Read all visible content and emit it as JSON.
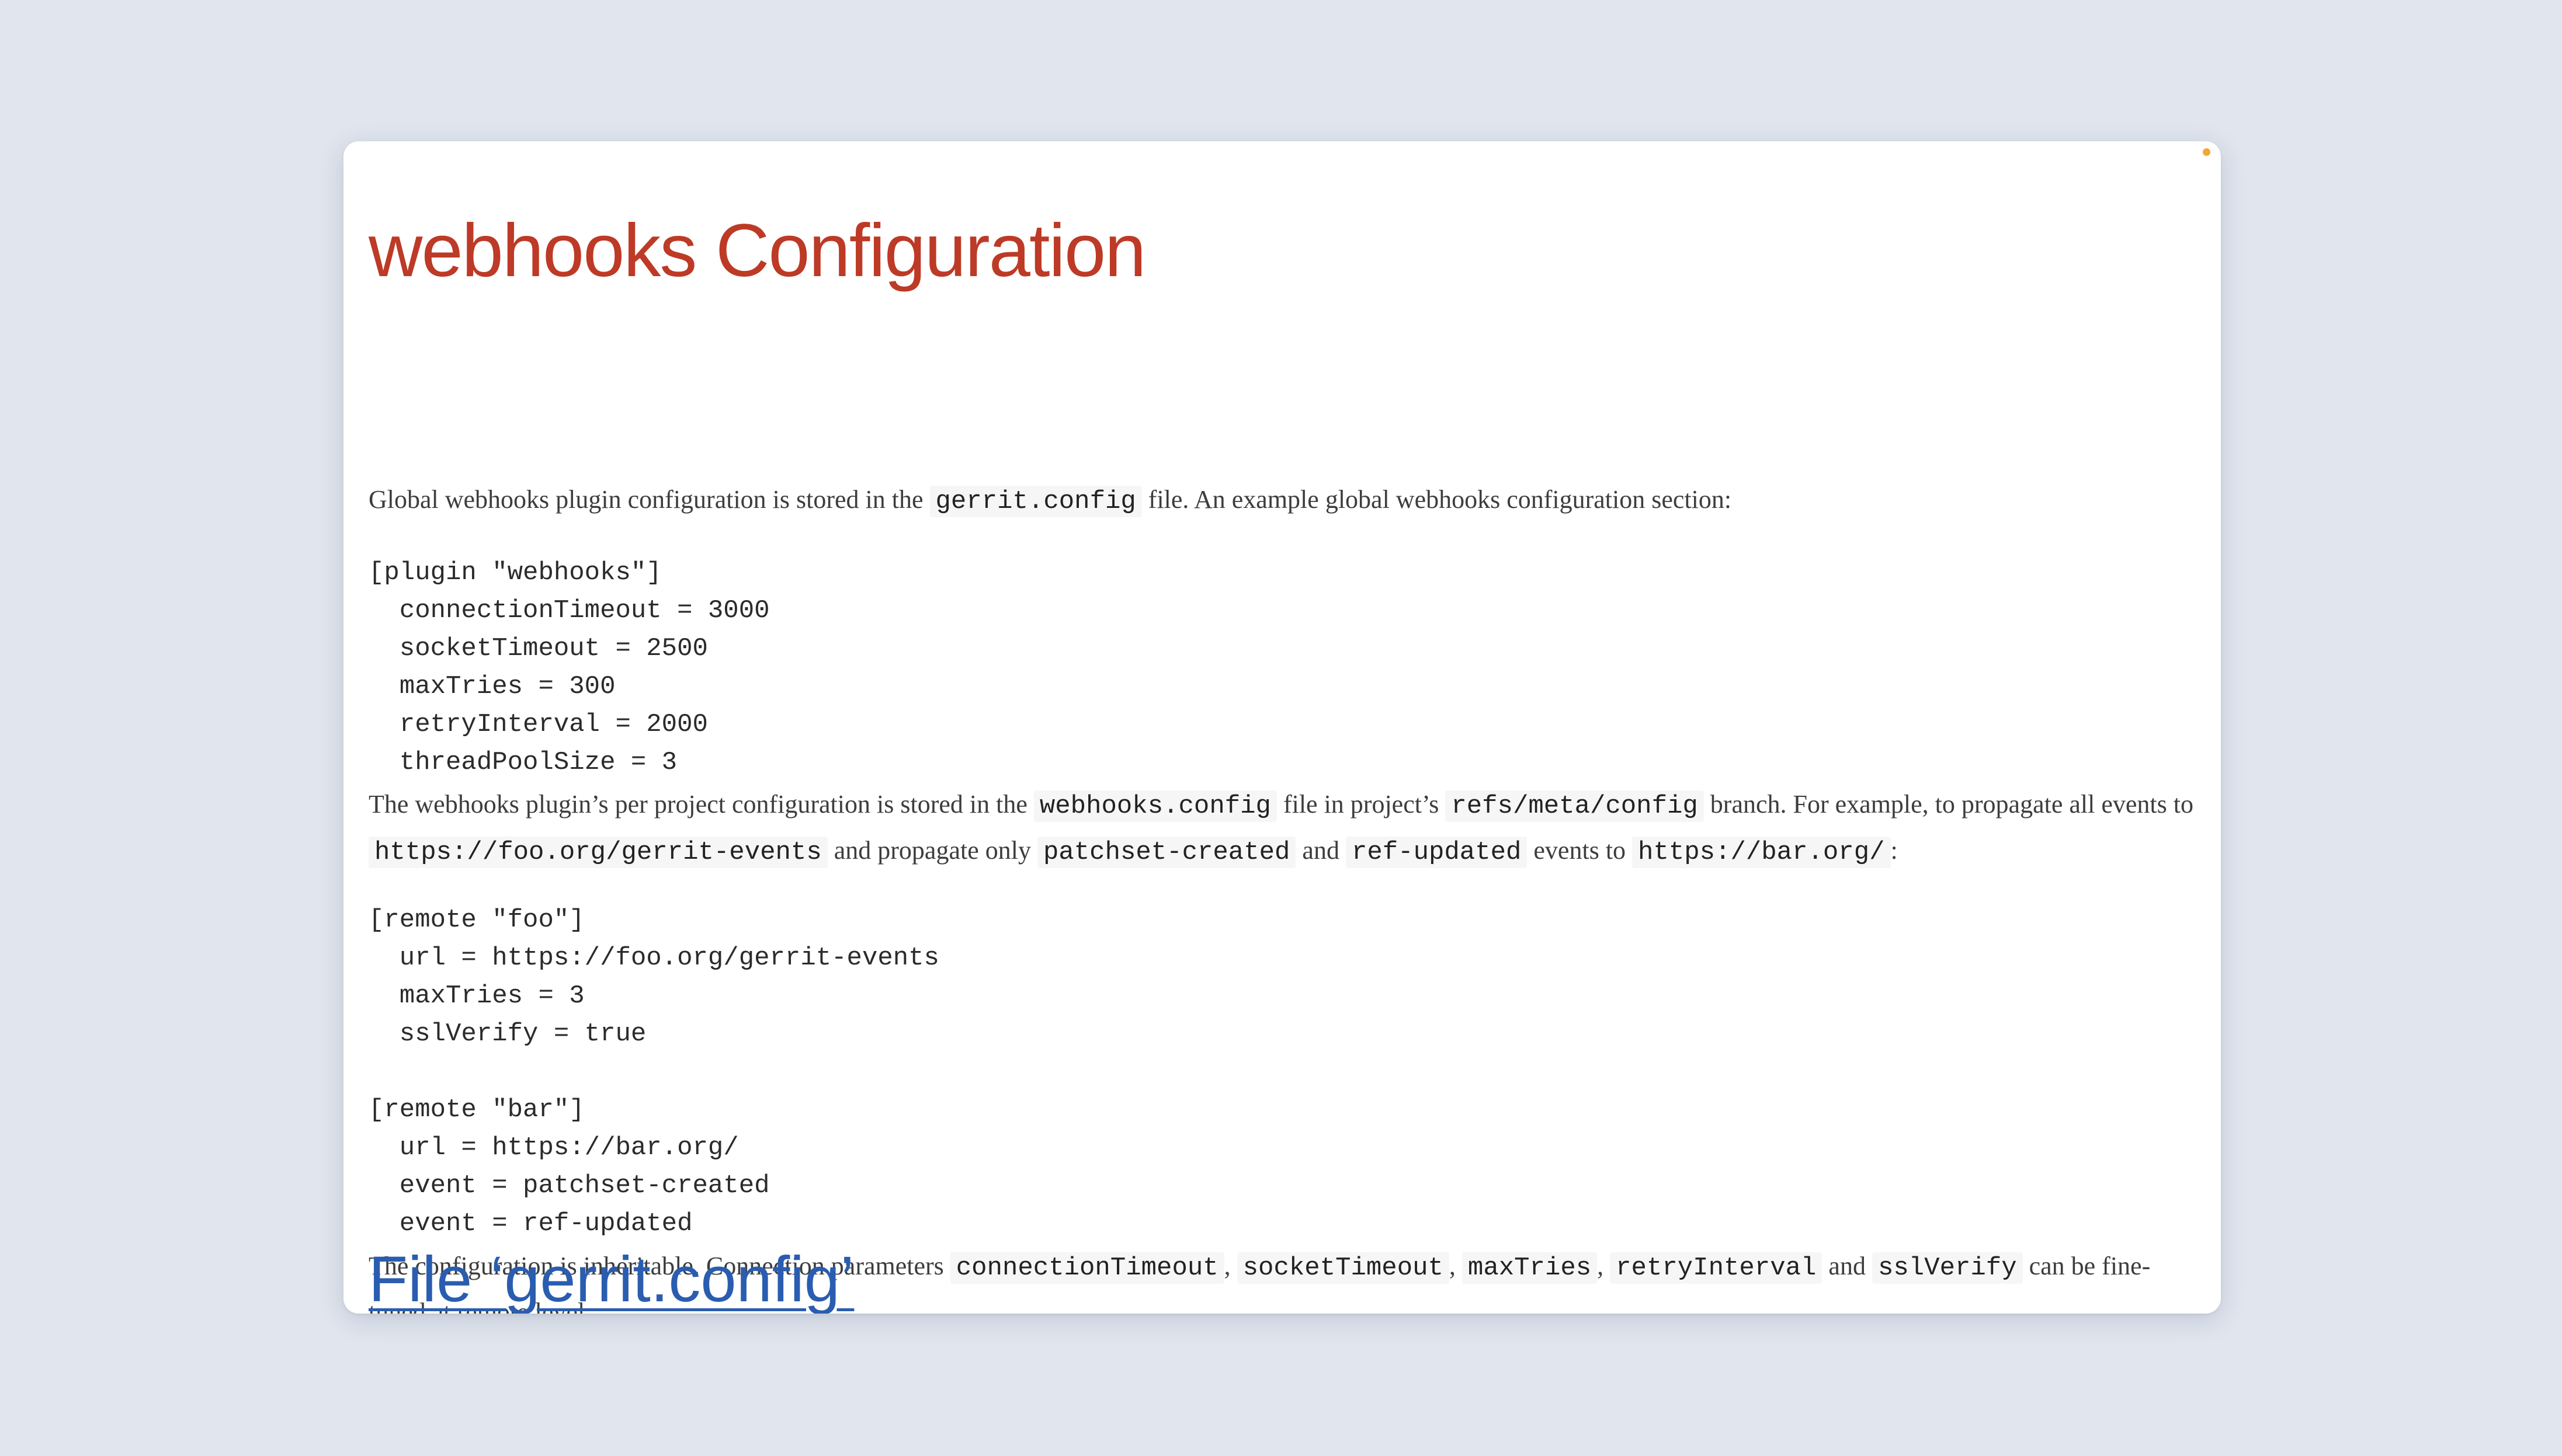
{
  "page": {
    "title": "webhooks Configuration"
  },
  "intro": {
    "t1": "Global webhooks plugin configuration is stored in the ",
    "c1": "gerrit.config",
    "t2": " file. An example global webhooks configuration section:"
  },
  "global_config_lines": [
    "[plugin \"webhooks\"]",
    "  connectionTimeout = 3000",
    "  socketTimeout = 2500",
    "  maxTries = 300",
    "  retryInterval = 2000",
    "  threadPoolSize = 3"
  ],
  "project_para": {
    "t1": "The webhooks plugin’s per project configuration is stored in the ",
    "c1": "webhooks.config",
    "t2": " file in project’s ",
    "c2": "refs/meta/config",
    "t3": " branch. For example, to propagate all events to ",
    "c3": "https://foo.org/gerrit-events",
    "t4": " and propagate only ",
    "c4": "patchset-created",
    "t5": " and ",
    "c5": "ref-updated",
    "t6": " events to ",
    "c6": "https://bar.org/",
    "t7": ":"
  },
  "remote_foo_lines": [
    "[remote \"foo\"]",
    "  url = https://foo.org/gerrit-events",
    "  maxTries = 3",
    "  sslVerify = true"
  ],
  "remote_bar_lines": [
    "[remote \"bar\"]",
    "  url = https://bar.org/",
    "  event = patchset-created",
    "  event = ref-updated"
  ],
  "inherit_para": {
    "t1": "The configuration is inheritable. Connection parameters ",
    "c1": "connectionTimeout",
    "t2": ", ",
    "c2": "socketTimeout",
    "t3": ", ",
    "c3": "maxTries",
    "t4": ", ",
    "c4": "retryInterval",
    "t5": " and ",
    "c5": "sslVerify",
    "t6": " can be fine-tuned at remote level."
  },
  "section": {
    "file_heading": "File ‘gerrit.config’"
  },
  "colors": {
    "title": "#bd3a26",
    "link": "#2a5db0",
    "status_dot": "#f0a830",
    "background": "#e0e5ee"
  }
}
